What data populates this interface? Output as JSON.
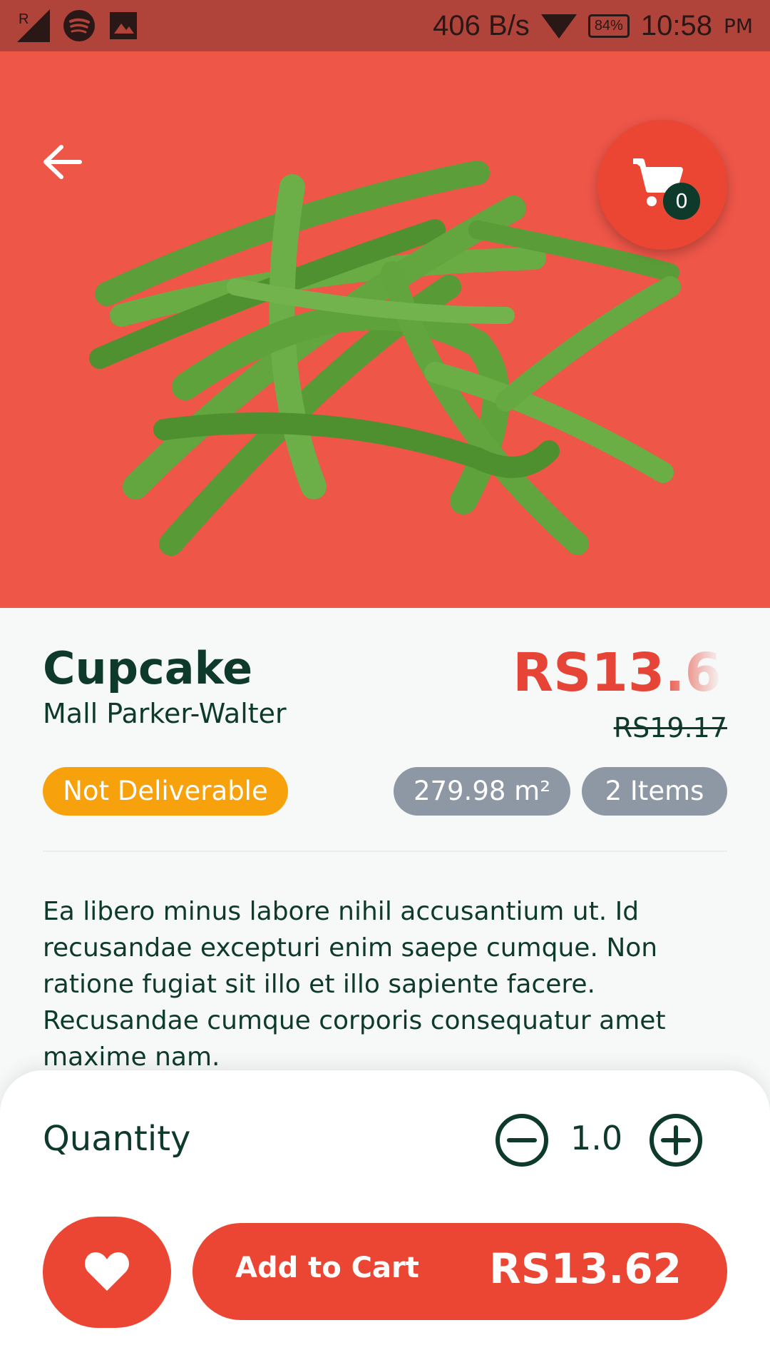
{
  "status_bar": {
    "net_speed": "406 B/s",
    "battery": "84%",
    "time": "10:58",
    "ampm": "PM"
  },
  "product": {
    "name": "Cupcake",
    "store": "Mall Parker-Walter",
    "price": "RS13.6",
    "old_price": "RS19.17",
    "delivery_badge": "Not Deliverable",
    "size_badge": "279.98 m²",
    "items_badge": "2 Items",
    "description": "Ea libero minus labore nihil accusantium ut. Id recusandae excepturi enim saepe cumque. Non ratione fugiat sit illo et illo sapiente facere. Recusandae cumque corporis consequatur amet maxime nam."
  },
  "cart": {
    "count": "0"
  },
  "quantity": {
    "label": "Quantity",
    "value": "1.0"
  },
  "actions": {
    "add_to_cart_label": "Add to Cart",
    "total": "RS13.62"
  },
  "colors": {
    "hero": "#ee5648",
    "accent": "#eb4633",
    "orange": "#f7a20d",
    "grey_badge": "#8e98a5",
    "text": "#0e3a2c"
  }
}
